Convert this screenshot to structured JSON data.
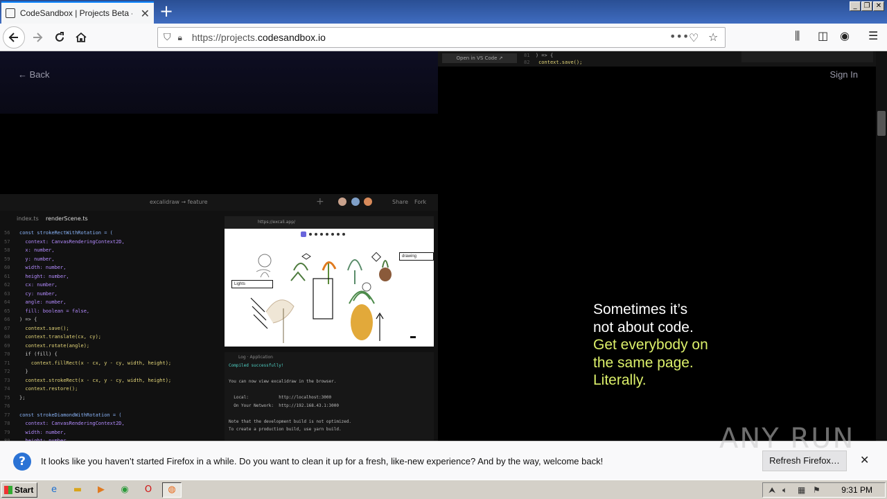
{
  "browser": {
    "tab_title": "CodeSandbox | Projects Beta - De",
    "url_prefix": "https://projects.",
    "url_domain": "codesandbox.io",
    "new_tab": "+",
    "more_icon": "•••"
  },
  "page": {
    "back_label": "← Back",
    "signin_label": "Sign In",
    "open_vscode_label": "Open in VS Code ↗",
    "top_code": [
      {
        "n": "81",
        "t": ") => {"
      },
      {
        "n": "82",
        "t": "  context.save();"
      }
    ],
    "editor": {
      "breadcrumb": "excalidraw → feature",
      "share_label": "Share",
      "fork_label": "Fork",
      "file_tabs": [
        "index.ts",
        "renderScene.ts"
      ],
      "lines": [
        {
          "n": "56",
          "t": "const strokeRectWithRotation = ("
        },
        {
          "n": "57",
          "t": "  context: CanvasRenderingContext2D,"
        },
        {
          "n": "58",
          "t": "  x: number,"
        },
        {
          "n": "59",
          "t": "  y: number,"
        },
        {
          "n": "60",
          "t": "  width: number,"
        },
        {
          "n": "61",
          "t": "  height: number,"
        },
        {
          "n": "62",
          "t": "  cx: number,"
        },
        {
          "n": "63",
          "t": "  cy: number,"
        },
        {
          "n": "64",
          "t": "  angle: number,"
        },
        {
          "n": "65",
          "t": "  fill: boolean = false,"
        },
        {
          "n": "66",
          "t": ") => {"
        },
        {
          "n": "67",
          "t": "  context.save();"
        },
        {
          "n": "68",
          "t": "  context.translate(cx, cy);"
        },
        {
          "n": "69",
          "t": "  context.rotate(angle);"
        },
        {
          "n": "70",
          "t": "  if (fill) {"
        },
        {
          "n": "71",
          "t": "    context.fillRect(x - cx, y - cy, width, height);"
        },
        {
          "n": "72",
          "t": "  }"
        },
        {
          "n": "73",
          "t": "  context.strokeRect(x - cx, y - cy, width, height);"
        },
        {
          "n": "74",
          "t": "  context.restore();"
        },
        {
          "n": "75",
          "t": "};"
        },
        {
          "n": "76",
          "t": ""
        },
        {
          "n": "77",
          "t": "const strokeDiamondWithRotation = ("
        },
        {
          "n": "78",
          "t": "  context: CanvasRenderingContext2D,"
        },
        {
          "n": "79",
          "t": "  width: number,"
        },
        {
          "n": "80",
          "t": "  height: number,"
        }
      ],
      "preview_url": "https://excali.app/",
      "label_lights": "Lights",
      "label_drawing": "drawing",
      "log_title": "Log · Application",
      "log_lines": [
        {
          "t": "Compiled successfully!",
          "ok": true
        },
        {
          "t": "",
          "ok": false
        },
        {
          "t": "You can now view excalidraw in the browser.",
          "ok": false
        },
        {
          "t": "",
          "ok": false
        },
        {
          "t": "  Local:            http://localhost:3000",
          "ok": false
        },
        {
          "t": "  On Your Network:  http://192.168.43.1:3000",
          "ok": false
        },
        {
          "t": "",
          "ok": false
        },
        {
          "t": "Note that the development build is not optimized.",
          "ok": false
        },
        {
          "t": "To create a production build, use yarn build.",
          "ok": false
        }
      ]
    },
    "tagline": {
      "line1": "Sometimes it’s",
      "line2": "not about code.",
      "line3": "Get everybody on",
      "line4": "the same page.",
      "line5": "Literally."
    },
    "accent_color": "#dcf06a"
  },
  "notification": {
    "message": "It looks like you haven’t started Firefox in a while. Do you want to clean it up for a fresh, like-new experience? And by the way, welcome back!",
    "refresh_label": "Refresh Firefox…",
    "close": "✕"
  },
  "watermark": "ANY RUN",
  "taskbar": {
    "start_label": "Start",
    "clock": "9:31 PM",
    "apps": [
      "ie-icon",
      "folder-icon",
      "media-icon",
      "chrome-icon",
      "opera-icon",
      "firefox-icon"
    ]
  }
}
